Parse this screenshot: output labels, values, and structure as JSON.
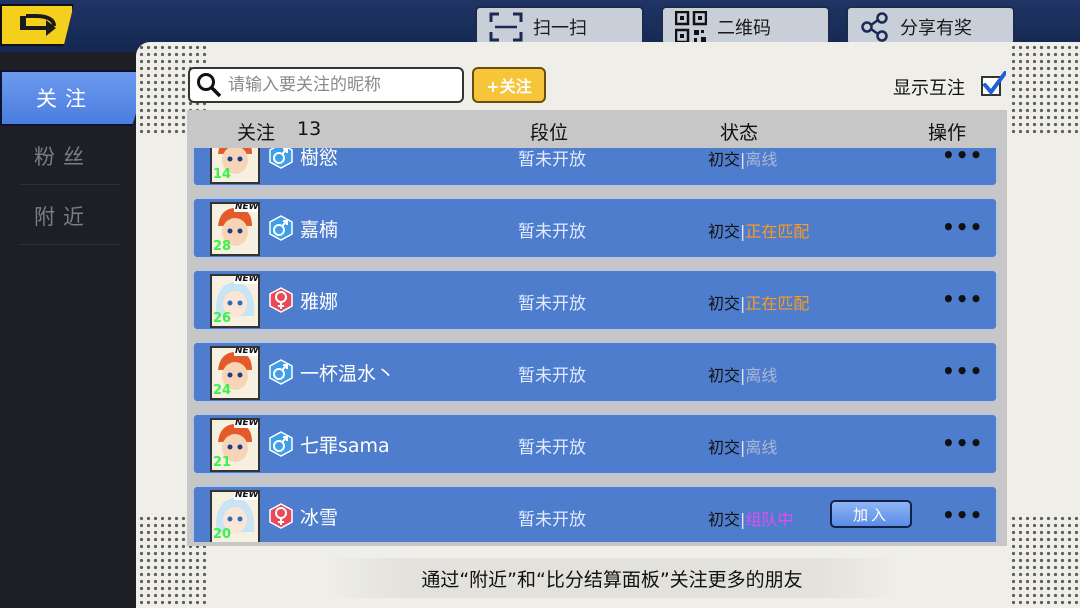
{
  "top_buttons": {
    "scan": "扫一扫",
    "qrcode": "二维码",
    "share": "分享有奖"
  },
  "sidebar": {
    "items": [
      {
        "label": "关注",
        "active": true
      },
      {
        "label": "粉丝",
        "active": false
      },
      {
        "label": "附近",
        "active": false
      }
    ]
  },
  "search": {
    "placeholder": "请输入要关注的昵称",
    "value": ""
  },
  "follow_button": "+关注",
  "mutual": {
    "label": "显示互注",
    "checked": true
  },
  "table": {
    "headers": {
      "follow": "关注",
      "count": "13",
      "rank": "段位",
      "status": "状态",
      "action": "操作"
    },
    "rows": [
      {
        "level": "14",
        "new": "",
        "gender": "male",
        "name": "樹慾",
        "rank": "暂未开放",
        "relation": "初交",
        "sep": "|",
        "status": "离线",
        "status_color": "#aab8d4",
        "join": "",
        "more": "•••"
      },
      {
        "level": "28",
        "new": "NEW",
        "gender": "male",
        "name": "嘉楠",
        "rank": "暂未开放",
        "relation": "初交",
        "sep": "|",
        "status": "正在匹配",
        "status_color": "#ff9a1a",
        "join": "",
        "more": "•••"
      },
      {
        "level": "26",
        "new": "NEW",
        "gender": "female",
        "name": "雅娜",
        "rank": "暂未开放",
        "relation": "初交",
        "sep": "|",
        "status": "正在匹配",
        "status_color": "#ff9a1a",
        "join": "",
        "more": "•••"
      },
      {
        "level": "24",
        "new": "NEW",
        "gender": "male",
        "name": "一杯温水丶",
        "rank": "暂未开放",
        "relation": "初交",
        "sep": "|",
        "status": "离线",
        "status_color": "#aab8d4",
        "join": "",
        "more": "•••"
      },
      {
        "level": "21",
        "new": "NEW",
        "gender": "male",
        "name": "七罪sama",
        "rank": "暂未开放",
        "relation": "初交",
        "sep": "|",
        "status": "离线",
        "status_color": "#aab8d4",
        "join": "",
        "more": "•••"
      },
      {
        "level": "20",
        "new": "NEW",
        "gender": "female",
        "name": "冰雪",
        "rank": "暂未开放",
        "relation": "初交",
        "sep": "|",
        "status": "组队中",
        "status_color": "#e04df0",
        "join": "加入",
        "more": "•••"
      }
    ]
  },
  "footer_text": "通过“附近”和“比分结算面板”关注更多的朋友",
  "colors": {
    "accent": "#4e7dcd",
    "gold": "#f4cf1c",
    "male": "#3ea0e6",
    "female": "#e84a5a"
  }
}
